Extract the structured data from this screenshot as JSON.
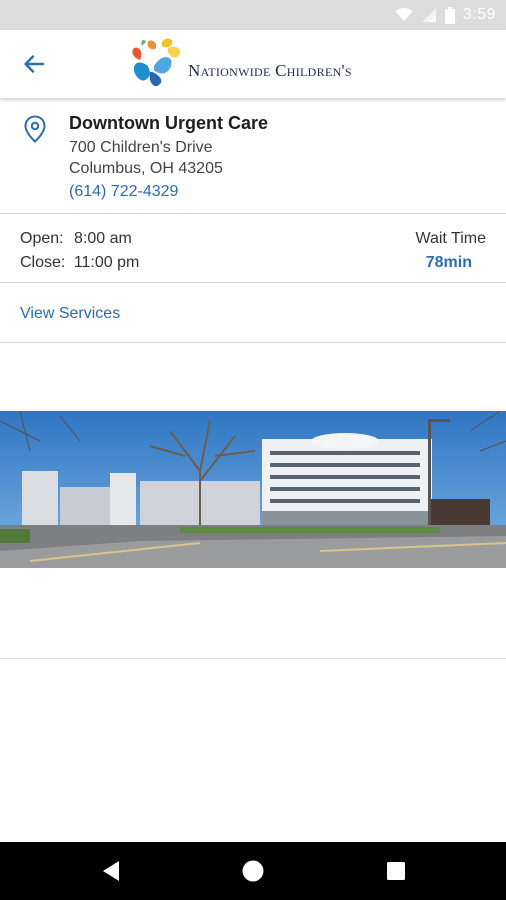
{
  "status_bar": {
    "time": "3:59",
    "icons": [
      "wifi-icon",
      "signal-icon",
      "battery-icon"
    ]
  },
  "app_bar": {
    "back_icon": "arrow-back-icon",
    "logo_text": "Nationwide Children's"
  },
  "location": {
    "name": "Downtown Urgent Care",
    "address_line1": "700 Children's Drive",
    "address_line2": "Columbus, OH 43205",
    "phone": "(614) 722-4329",
    "icon": "location-pin-icon"
  },
  "hours": {
    "open_label": "Open:",
    "open_time": "8:00 am",
    "close_label": "Close:",
    "close_time": "11:00 pm",
    "wait_label": "Wait Time",
    "wait_value": "78min"
  },
  "services": {
    "link_label": "View Services"
  },
  "nav": {
    "buttons": [
      "back-triangle-icon",
      "home-circle-icon",
      "recents-square-icon"
    ]
  },
  "colors": {
    "accent": "#2c6cb0",
    "status_bar": "#dcdcdc",
    "nav_bar": "#000000"
  }
}
